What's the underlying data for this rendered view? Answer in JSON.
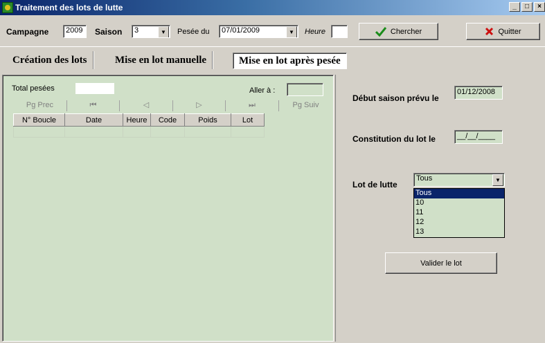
{
  "window": {
    "title": "Traitement des lots de lutte",
    "controls": [
      "_",
      "□",
      "×"
    ]
  },
  "toolbar": {
    "campagne_label": "Campagne",
    "campagne_value": "2009",
    "saison_label": "Saison",
    "saison_value": "3",
    "pesee_label": "Pesée du",
    "pesee_value": "07/01/2009",
    "heure_label": "Heure",
    "heure_value": "",
    "chercher_label": "Chercher",
    "chercher_accel": "C",
    "quitter_label": "Quitter",
    "quitter_accel": "Q",
    "accent_green": "#1a8c1a",
    "accent_red": "#cc1010"
  },
  "tabs": [
    {
      "label": "Création des lots"
    },
    {
      "label": "Mise en lot manuelle"
    },
    {
      "label": "Mise en lot après pesée",
      "active": true
    }
  ],
  "left_panel": {
    "total_label": "Total pesées",
    "total_value": "",
    "aller_label": "Aller à :",
    "aller_value": "",
    "nav": {
      "prev_page": "Pg Prec",
      "first": "⏮",
      "prev": "◁",
      "next": "▷",
      "last": "⏭",
      "next_page": "Pg Suiv"
    },
    "columns": [
      "N° Boucle",
      "Date",
      "Heure",
      "Code",
      "Poids",
      "Lot"
    ],
    "rows": []
  },
  "right_panel": {
    "debut_label": "Début saison prévu le",
    "debut_value": "01/12/2008",
    "constitution_label": "Constitution du lot le",
    "constitution_value": "__/__/____",
    "lot_label": "Lot de lutte",
    "lot_selected": "Tous",
    "lot_options": [
      "Tous",
      "10",
      "11",
      "12",
      "13"
    ],
    "valider_label": "Valider le lot",
    "valider_accel": "V"
  },
  "colors": {
    "panel_green": "#d0e0c8",
    "window_gray": "#d4d0c8",
    "selection_blue": "#0a246a"
  }
}
